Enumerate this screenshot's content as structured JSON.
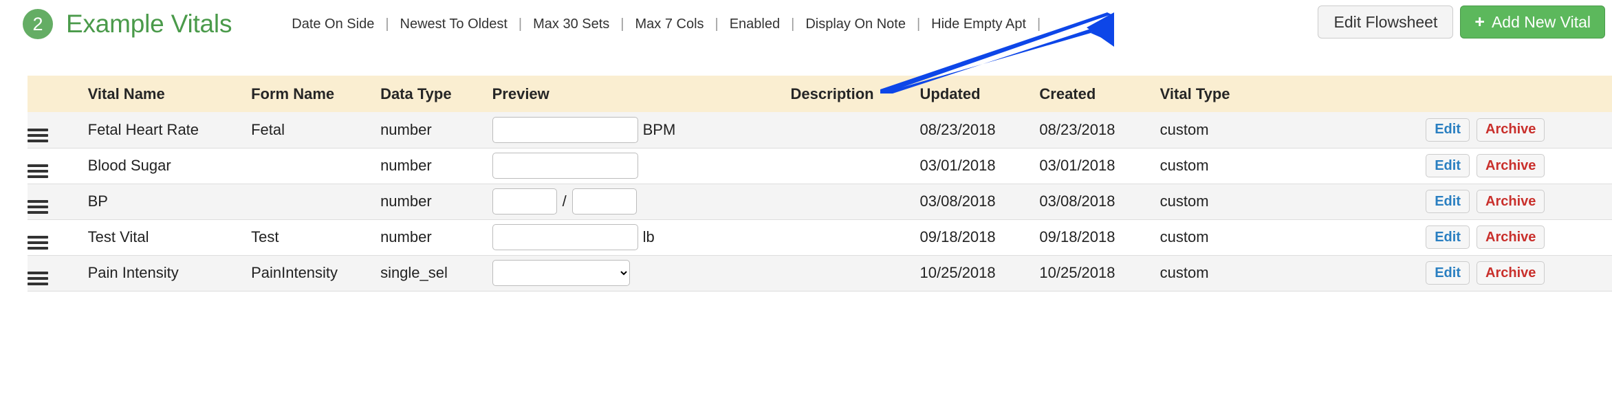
{
  "header": {
    "badge_number": "2",
    "title": "Example Vitals",
    "toolbar_links": [
      "Date On Side",
      "Newest To Oldest",
      "Max 30 Sets",
      "Max 7 Cols",
      "Enabled",
      "Display On Note",
      "Hide Empty Apt"
    ],
    "separator": "|",
    "edit_flowsheet_label": "Edit Flowsheet",
    "add_new_vital_label": "Add New Vital",
    "add_new_vital_plus": "+",
    "badge_color": "#64ad64",
    "title_color": "#4a9a4a",
    "add_button_color": "#5cb85c"
  },
  "annotation": {
    "arrow_color": "#0d46e8",
    "points_to": "add-new-vital-button"
  },
  "table": {
    "header_bg": "#faeed1",
    "columns": [
      "",
      "Vital Name",
      "Form Name",
      "Data Type",
      "Preview",
      "Description",
      "Updated",
      "Created",
      "Vital Type",
      ""
    ],
    "row_actions": {
      "edit_label": "Edit",
      "archive_label": "Archive",
      "edit_color": "#2a7fc1",
      "archive_color": "#c9302c"
    },
    "rows": [
      {
        "vital_name": "Fetal Heart Rate",
        "form_name": "Fetal",
        "data_type": "number",
        "preview_kind": "input",
        "preview_value": "",
        "preview_unit": "BPM",
        "description": "",
        "updated": "08/23/2018",
        "created": "08/23/2018",
        "vital_type": "custom"
      },
      {
        "vital_name": "Blood Sugar",
        "form_name": "",
        "data_type": "number",
        "preview_kind": "input",
        "preview_value": "",
        "preview_unit": "",
        "description": "",
        "updated": "03/01/2018",
        "created": "03/01/2018",
        "vital_type": "custom"
      },
      {
        "vital_name": "BP",
        "form_name": "",
        "data_type": "number",
        "preview_kind": "input-pair",
        "preview_value": "",
        "preview_value2": "",
        "preview_separator": "/",
        "preview_unit": "",
        "description": "",
        "updated": "03/08/2018",
        "created": "03/08/2018",
        "vital_type": "custom"
      },
      {
        "vital_name": "Test Vital",
        "form_name": "Test",
        "data_type": "number",
        "preview_kind": "input",
        "preview_value": "",
        "preview_unit": "lb",
        "description": "",
        "updated": "09/18/2018",
        "created": "09/18/2018",
        "vital_type": "custom"
      },
      {
        "vital_name": "Pain Intensity",
        "form_name": "PainIntensity",
        "data_type": "single_sel",
        "preview_kind": "select",
        "preview_value": "",
        "preview_unit": "",
        "description": "",
        "updated": "10/25/2018",
        "created": "10/25/2018",
        "vital_type": "custom"
      }
    ]
  }
}
